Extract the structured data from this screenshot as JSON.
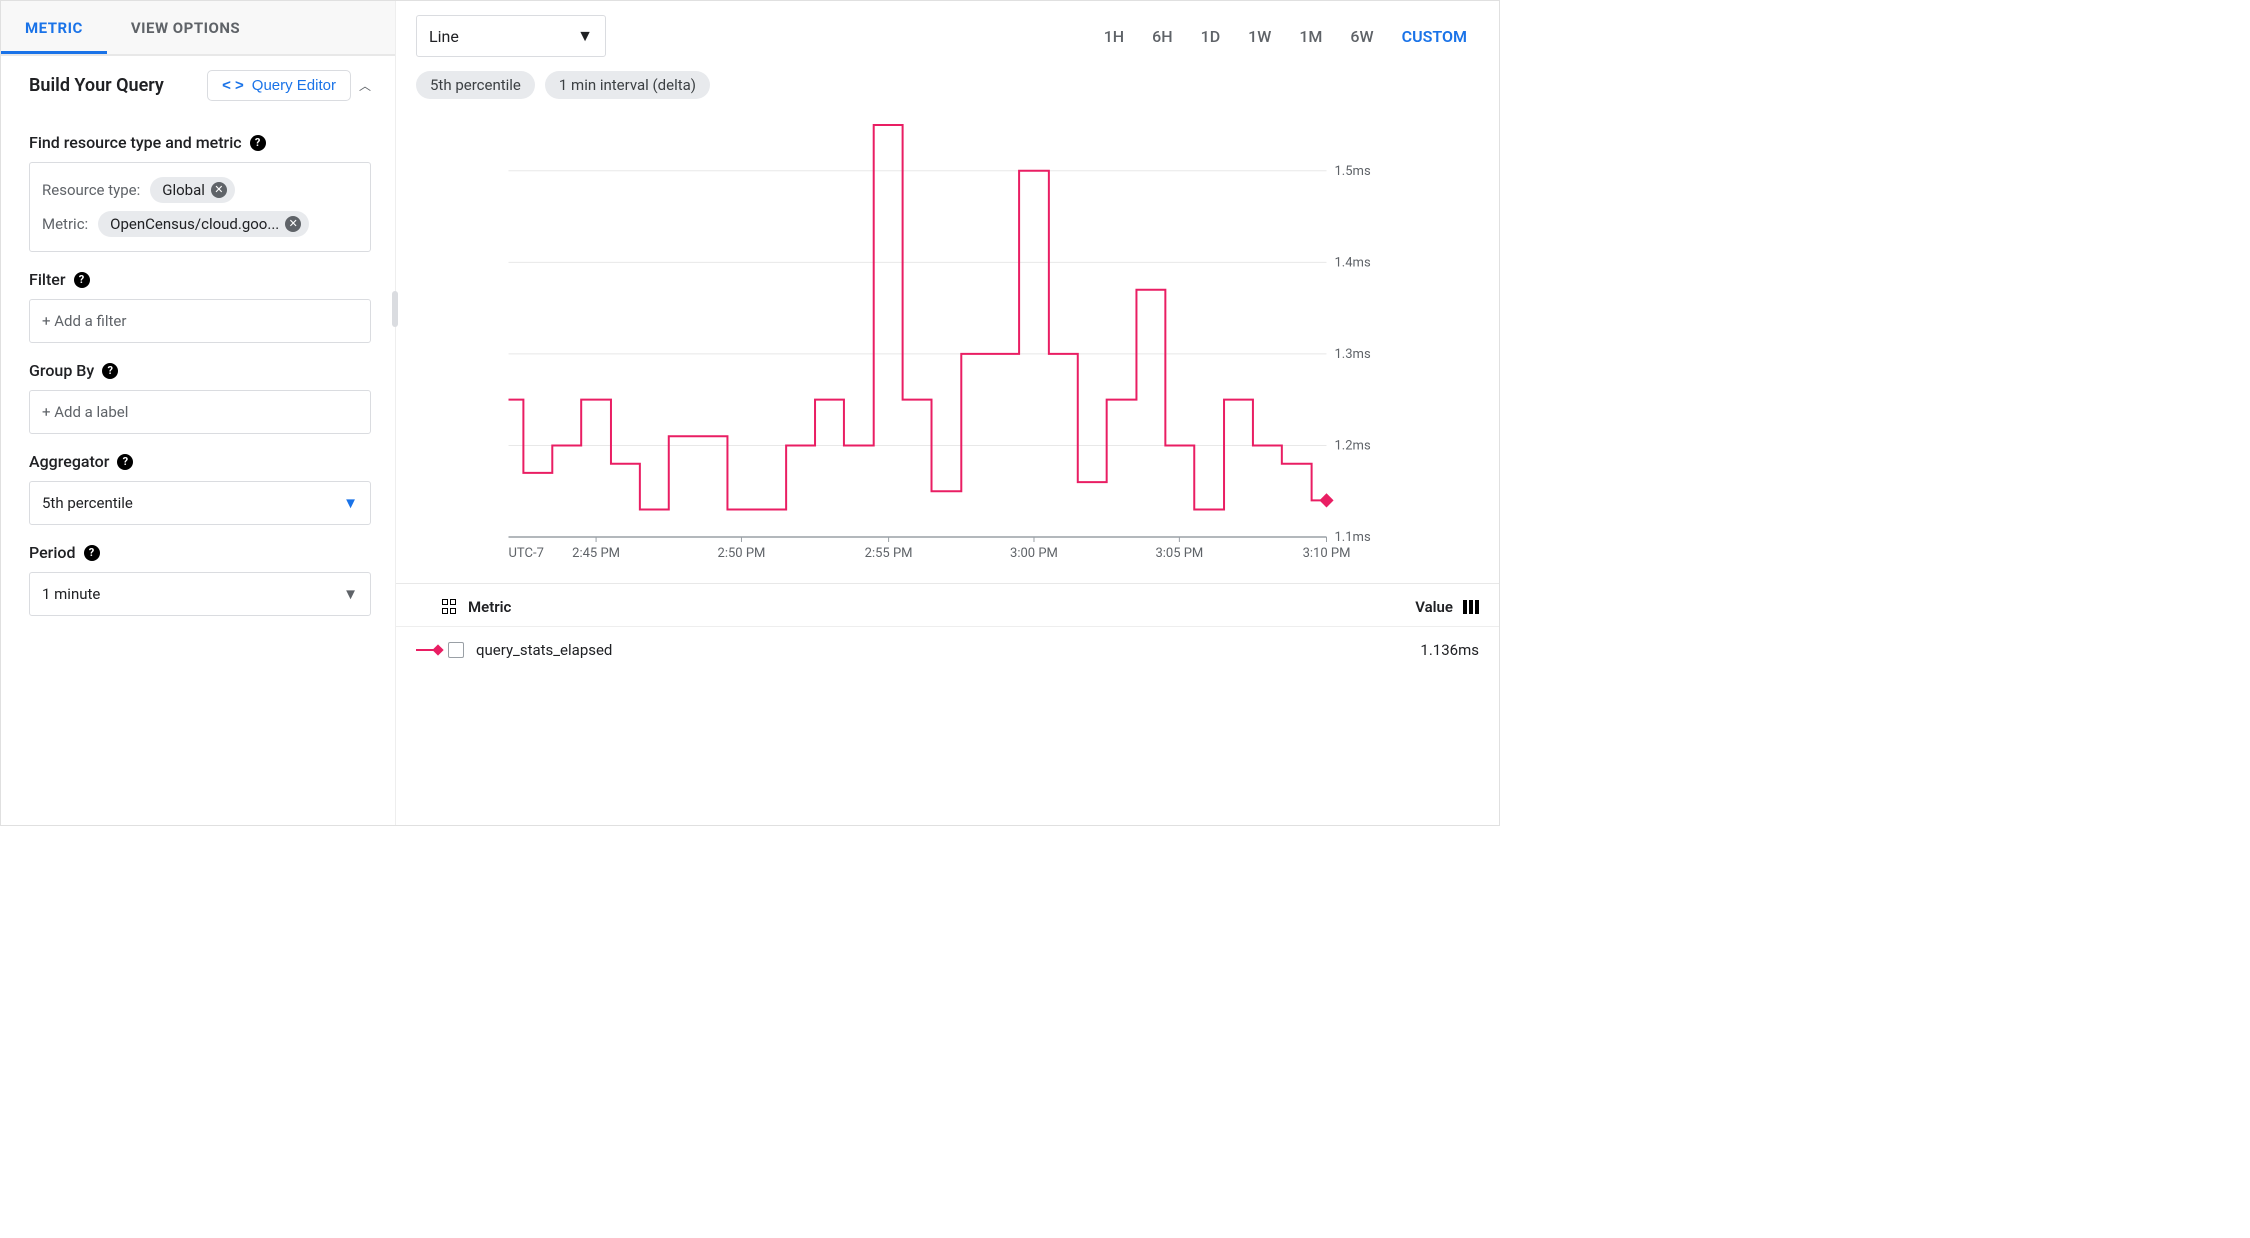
{
  "tabs": {
    "metric": "METRIC",
    "view_options": "VIEW OPTIONS"
  },
  "query_header": {
    "title": "Build Your Query",
    "editor_btn": "Query Editor"
  },
  "find": {
    "title": "Find resource type and metric",
    "resource_type_label": "Resource type:",
    "resource_type_value": "Global",
    "metric_label": "Metric:",
    "metric_value": "OpenCensus/cloud.goo..."
  },
  "filter": {
    "title": "Filter",
    "placeholder": "+ Add a filter"
  },
  "group_by": {
    "title": "Group By",
    "placeholder": "+ Add a label"
  },
  "aggregator": {
    "title": "Aggregator",
    "value": "5th percentile"
  },
  "period": {
    "title": "Period",
    "value": "1 minute"
  },
  "viz": {
    "type": "Line"
  },
  "ranges": [
    "1H",
    "6H",
    "1D",
    "1W",
    "1M",
    "6W",
    "CUSTOM"
  ],
  "active_range": "CUSTOM",
  "pills": [
    "5th percentile",
    "1 min interval (delta)"
  ],
  "legend": {
    "metric_header": "Metric",
    "value_header": "Value",
    "series_name": "query_stats_elapsed",
    "series_value": "1.136ms"
  },
  "chart_data": {
    "type": "line",
    "x_unit": "time",
    "timezone_label": "UTC-7",
    "x_ticks": [
      "2:45 PM",
      "2:50 PM",
      "2:55 PM",
      "3:00 PM",
      "3:05 PM",
      "3:10 PM"
    ],
    "y_ticks": [
      "1.1ms",
      "1.2ms",
      "1.3ms",
      "1.4ms",
      "1.5ms"
    ],
    "ylim": [
      1.1,
      1.55
    ],
    "series": [
      {
        "name": "query_stats_elapsed",
        "color": "#e91e63",
        "x": [
          2.7,
          2.717,
          2.733,
          2.75,
          2.767,
          2.783,
          2.8,
          2.817,
          2.833,
          2.85,
          2.867,
          2.883,
          2.9,
          2.917,
          2.933,
          2.95,
          2.967,
          2.983,
          3.0,
          3.017,
          3.033,
          3.05,
          3.067,
          3.083,
          3.1,
          3.117,
          3.133,
          3.15,
          3.167
        ],
        "y": [
          1.25,
          1.17,
          1.2,
          1.25,
          1.18,
          1.13,
          1.21,
          1.21,
          1.13,
          1.13,
          1.2,
          1.25,
          1.2,
          1.55,
          1.25,
          1.15,
          1.3,
          1.3,
          1.5,
          1.3,
          1.16,
          1.25,
          1.37,
          1.2,
          1.13,
          1.25,
          1.2,
          1.18,
          1.14
        ]
      }
    ]
  }
}
